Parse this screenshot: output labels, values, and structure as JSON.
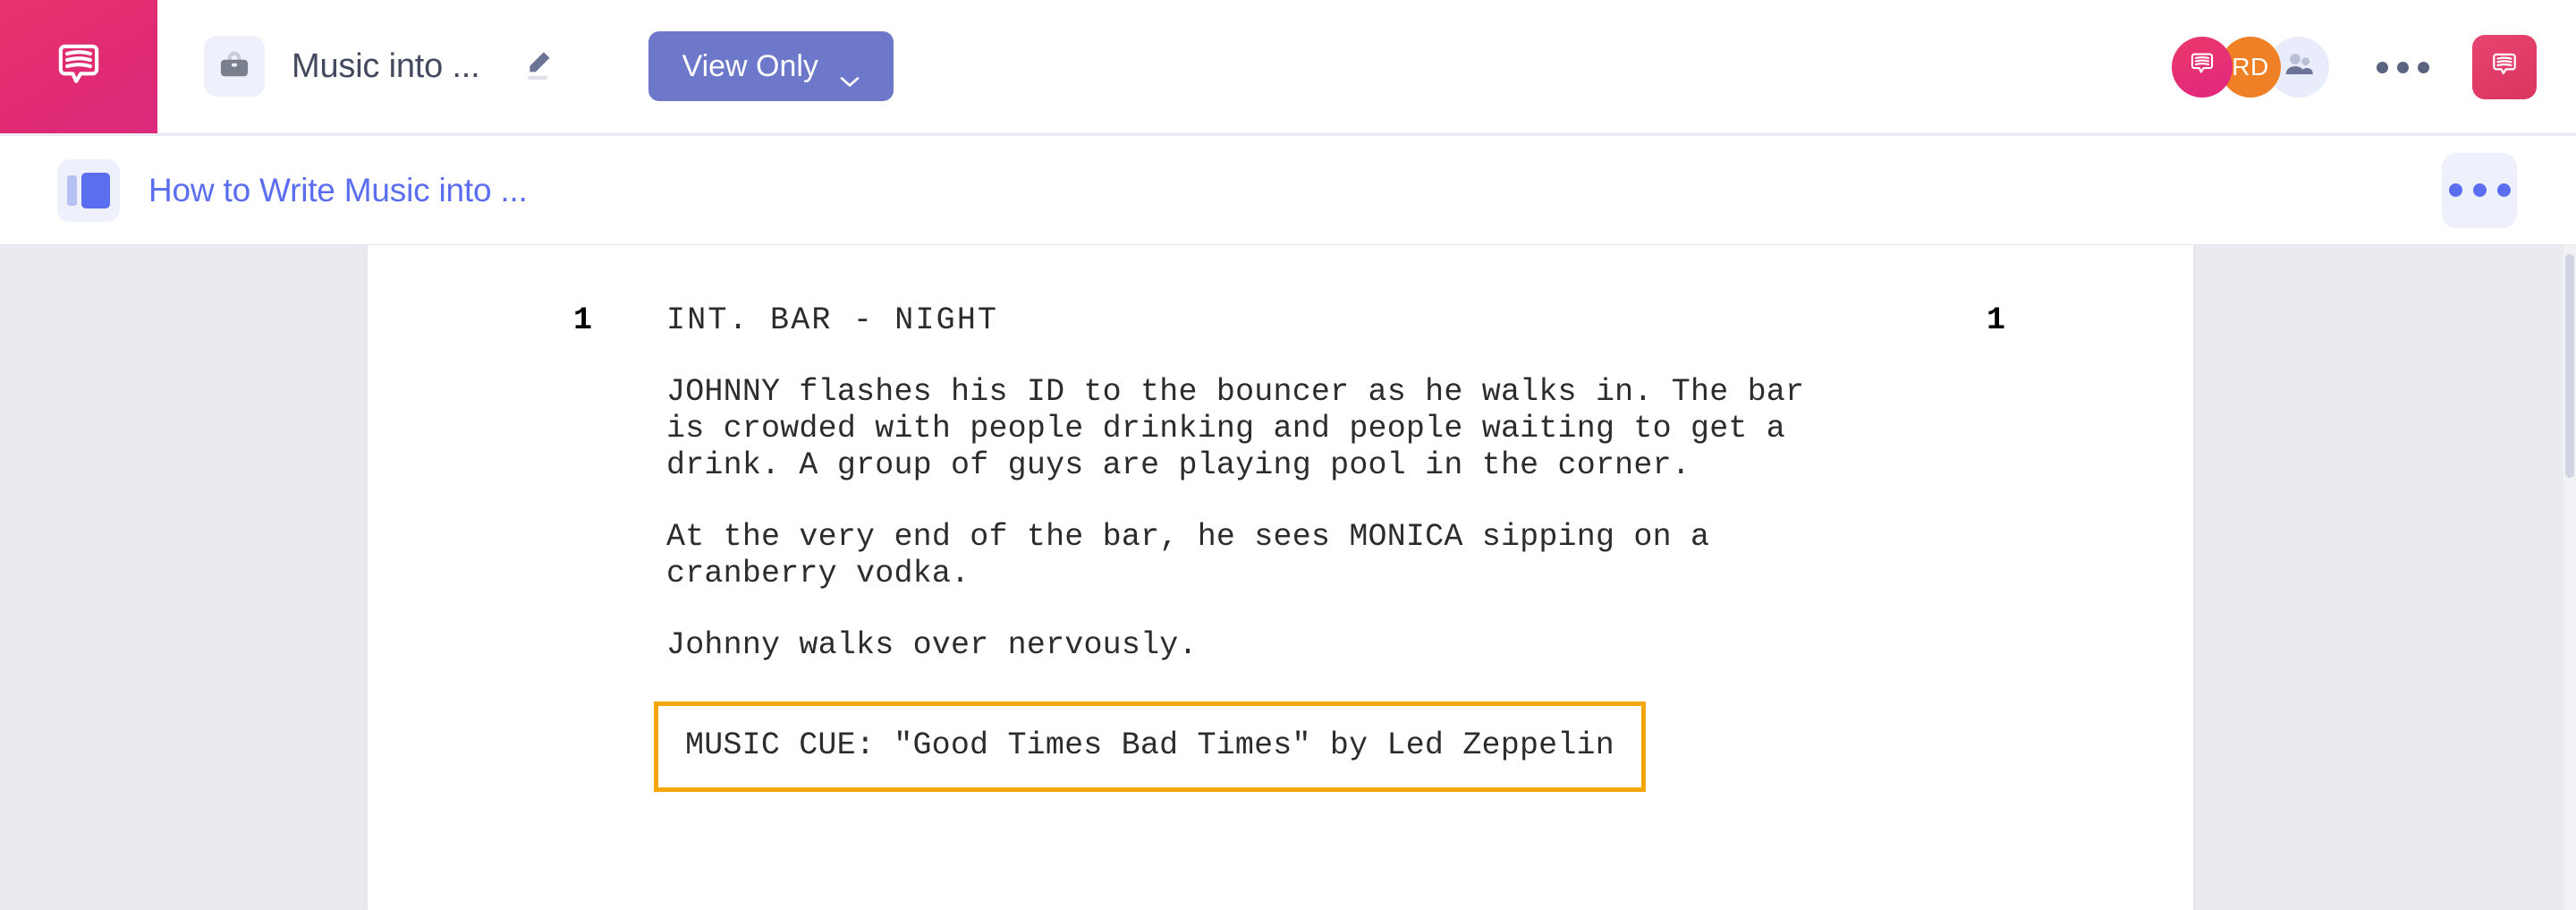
{
  "header": {
    "logo_icon": "speech-bubble-script-logo",
    "doc_badge_icon": "briefcase-lock-icon",
    "doc_title": "Music into ...",
    "edit_icon": "pencil-edit-icon",
    "mode_button": {
      "label": "View Only",
      "chevron_icon": "chevron-down-icon",
      "color": "#6e78cb"
    },
    "avatars": [
      {
        "name": "app-avatar",
        "initials": "",
        "icon": "speech-bubble-icon",
        "color": "#e0267f"
      },
      {
        "name": "user-avatar",
        "initials": "RD",
        "icon": "",
        "color": "#ef8025"
      },
      {
        "name": "collaborators-avatar",
        "initials": "",
        "icon": "people-icon",
        "color": "#e9ecfa"
      }
    ],
    "overflow_icon": "three-dots-icon",
    "brand_button_icon": "speech-bubble-icon",
    "brand_color": "#e02a72"
  },
  "breadcrumb": {
    "doc_icon": "document-outline-icon",
    "label": "How to Write Music into ...",
    "link_color": "#5b6ef0",
    "more_icon": "three-dots-icon"
  },
  "document": {
    "scene": {
      "number_left": "1",
      "number_right": "1",
      "heading": "INT. BAR - NIGHT"
    },
    "action_blocks": [
      "JOHNNY flashes his ID to the bouncer as he walks in. The bar\nis crowded with people drinking and people waiting to get a\ndrink. A group of guys are playing pool in the corner.",
      "At the very end of the bar, he sees MONICA sipping on a\ncranberry vodka.",
      "Johnny walks over nervously."
    ],
    "music_cue": {
      "text": "MUSIC CUE: \"Good Times Bad Times\" by Led Zeppelin",
      "highlight_color": "#f6a608"
    }
  }
}
